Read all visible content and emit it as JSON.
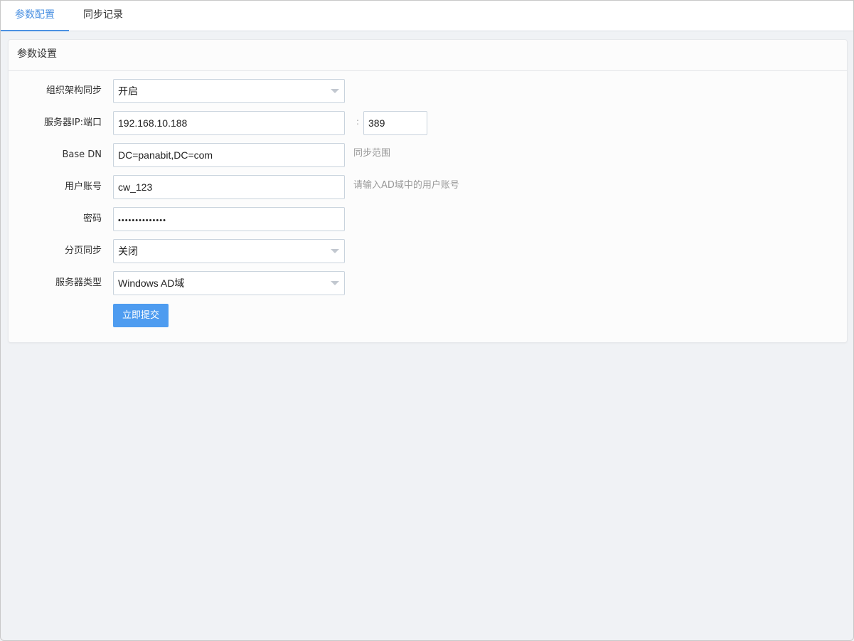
{
  "tabs": [
    {
      "label": "参数配置"
    },
    {
      "label": "同步记录"
    }
  ],
  "panel": {
    "title": "参数设置",
    "fields": {
      "org_sync": {
        "label": "组织架构同步",
        "value": "开启"
      },
      "server": {
        "label": "服务器IP:端口",
        "ip": "192.168.10.188",
        "separator": ":",
        "port": "389"
      },
      "base_dn": {
        "label": "Base DN",
        "value": "DC=panabit,DC=com",
        "hint": "同步范围"
      },
      "account": {
        "label": "用户账号",
        "value": "cw_123",
        "hint": "请输入AD域中的用户账号"
      },
      "password": {
        "label": "密码",
        "value": "••••••••••••••"
      },
      "paging": {
        "label": "分页同步",
        "value": "关闭"
      },
      "server_type": {
        "label": "服务器类型",
        "value": "Windows AD域"
      }
    },
    "submit_label": "立即提交"
  },
  "colors": {
    "accent": "#4a90e2",
    "button": "#4e9cf0",
    "background": "#f0f2f5"
  }
}
